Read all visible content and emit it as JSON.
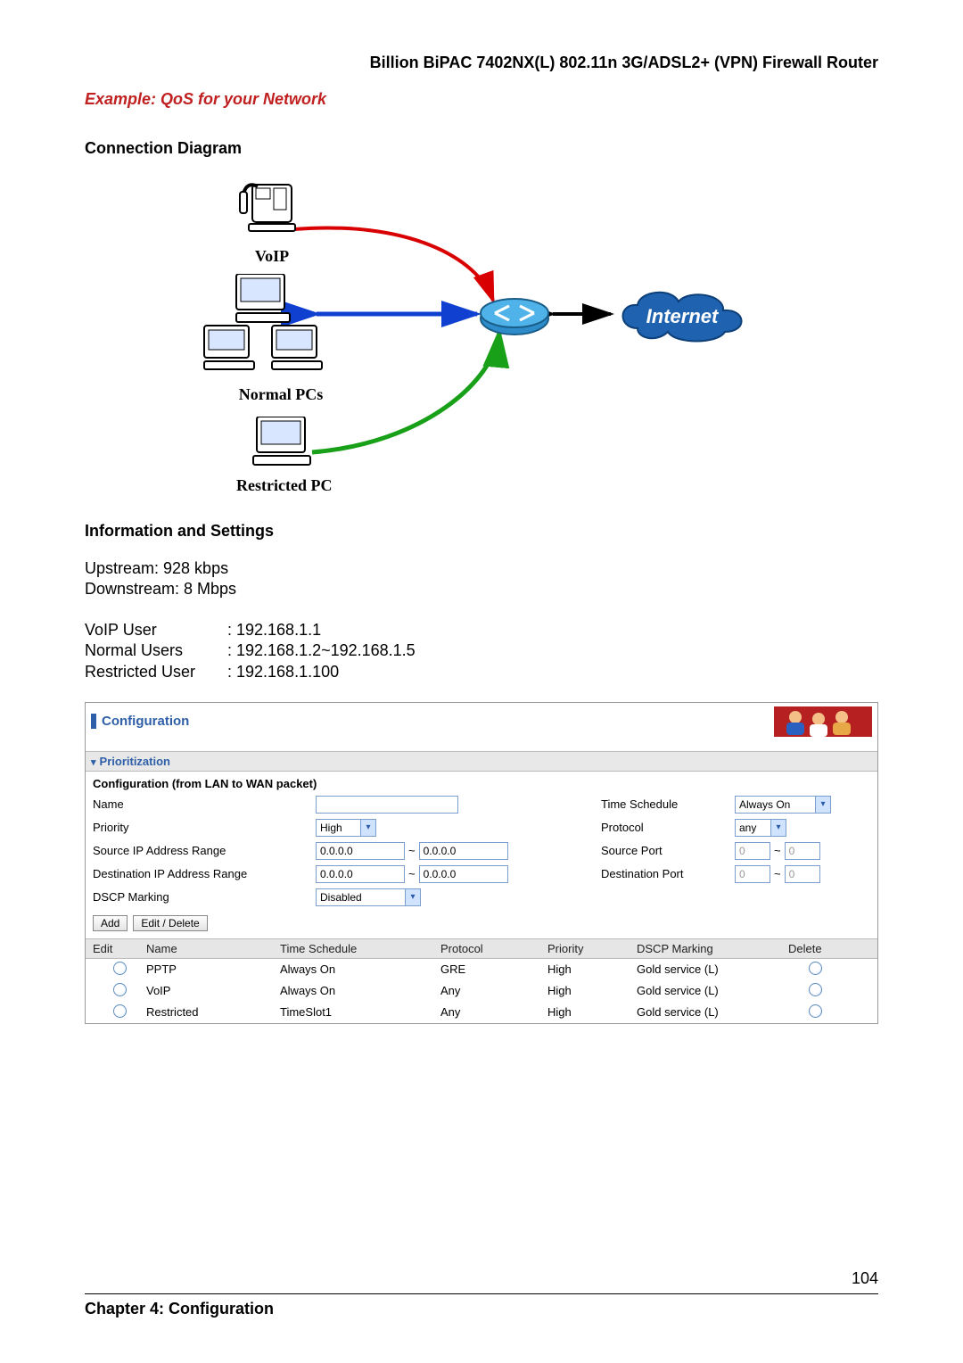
{
  "doc": {
    "header": "Billion BiPAC 7402NX(L) 802.11n 3G/ADSL2+ (VPN) Firewall Router",
    "example_title": "Example: QoS for your Network",
    "chapter": "Chapter 4: Configuration",
    "page_number": "104"
  },
  "diagram": {
    "heading": "Connection Diagram",
    "voip_label": "VoIP",
    "normal_label": "Normal PCs",
    "restricted_label": "Restricted PC",
    "internet_label": "Internet"
  },
  "info": {
    "heading": "Information and Settings",
    "upstream": "Upstream: 928 kbps",
    "downstream": "Downstream: 8 Mbps",
    "voip_user_label": "VoIP User",
    "voip_user_value": ": 192.168.1.1",
    "normal_users_label": "Normal Users",
    "normal_users_value": ": 192.168.1.2~192.168.1.5",
    "restricted_user_label": "Restricted User",
    "restricted_user_value": ": 192.168.1.100"
  },
  "cfg": {
    "title": "Configuration",
    "section": "Prioritization",
    "form_title": "Configuration (from LAN to WAN packet)",
    "labels": {
      "name": "Name",
      "time_schedule": "Time Schedule",
      "priority": "Priority",
      "protocol": "Protocol",
      "src_range": "Source IP Address Range",
      "src_port": "Source Port",
      "dst_range": "Destination IP Address Range",
      "dst_port": "Destination Port",
      "dscp": "DSCP Marking"
    },
    "values": {
      "name": "",
      "time_schedule": "Always On",
      "priority": "High",
      "protocol": "any",
      "src_from": "0.0.0.0",
      "src_to": "0.0.0.0",
      "src_port_from": "0",
      "src_port_to": "0",
      "dst_from": "0.0.0.0",
      "dst_to": "0.0.0.0",
      "dst_port_from": "0",
      "dst_port_to": "0",
      "dscp": "Disabled"
    },
    "buttons": {
      "add": "Add",
      "edit_delete": "Edit / Delete"
    },
    "table": {
      "headers": {
        "edit": "Edit",
        "name": "Name",
        "time_schedule": "Time Schedule",
        "protocol": "Protocol",
        "priority": "Priority",
        "dscp": "DSCP Marking",
        "delete": "Delete"
      },
      "rows": [
        {
          "name": "PPTP",
          "time": "Always On",
          "protocol": "GRE",
          "priority": "High",
          "dscp": "Gold service (L)"
        },
        {
          "name": "VoIP",
          "time": "Always On",
          "protocol": "Any",
          "priority": "High",
          "dscp": "Gold service (L)"
        },
        {
          "name": "Restricted",
          "time": "TimeSlot1",
          "protocol": "Any",
          "priority": "High",
          "dscp": "Gold service (L)"
        }
      ]
    }
  }
}
